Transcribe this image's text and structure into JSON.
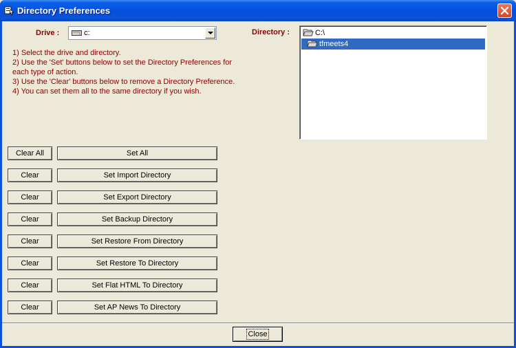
{
  "window": {
    "title": "Directory Preferences"
  },
  "drive": {
    "label": "Drive :",
    "value": "c:"
  },
  "directory": {
    "label": "Directory :",
    "items": [
      {
        "label": "C:\\",
        "selected": false
      },
      {
        "label": "tfmeets4",
        "selected": true
      }
    ]
  },
  "instructions": [
    "1) Select the drive and directory.",
    "2) Use the 'Set' buttons below to set the Directory Preferences for",
    "each type of action.",
    "3) Use the 'Clear' buttons below to remove a Directory Preference.",
    "4) You can set them all to the same directory if you wish."
  ],
  "rows": [
    {
      "clear_label": "Clear All",
      "set_label": "Set All"
    },
    {
      "clear_label": "Clear",
      "set_label": "Set Import Directory"
    },
    {
      "clear_label": "Clear",
      "set_label": "Set Export Directory"
    },
    {
      "clear_label": "Clear",
      "set_label": "Set Backup Directory"
    },
    {
      "clear_label": "Clear",
      "set_label": "Set Restore From Directory"
    },
    {
      "clear_label": "Clear",
      "set_label": "Set Restore To Directory"
    },
    {
      "clear_label": "Clear",
      "set_label": "Set Flat HTML To Directory"
    },
    {
      "clear_label": "Clear",
      "set_label": "Set AP News To Directory"
    }
  ],
  "footer": {
    "close_label": "Close"
  },
  "colors": {
    "label_red": "#8B0000",
    "selection_blue": "#316AC5",
    "titlebar_blue": "#0550DD"
  }
}
